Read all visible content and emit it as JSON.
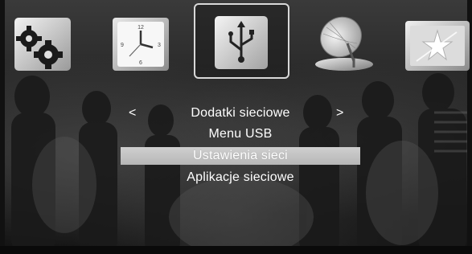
{
  "top_menu": {
    "icons": [
      {
        "name": "settings-gears-icon",
        "selected": false
      },
      {
        "name": "clock-icon",
        "selected": false
      },
      {
        "name": "usb-drive-icon",
        "selected": true
      },
      {
        "name": "satellite-dish-icon",
        "selected": false
      },
      {
        "name": "media-star-icon",
        "selected": false
      }
    ]
  },
  "submenu": {
    "nav_left": "<",
    "nav_right": ">",
    "title": "Dodatki sieciowe",
    "items": [
      {
        "label": "Menu USB",
        "selected": false
      },
      {
        "label": "Ustawienia sieci",
        "selected": true
      },
      {
        "label": "Aplikacje sieciowe",
        "selected": false
      }
    ]
  },
  "colors": {
    "highlight": "#c4c4c4",
    "text": "#ffffff",
    "selection_border": "#d8d8d8"
  }
}
